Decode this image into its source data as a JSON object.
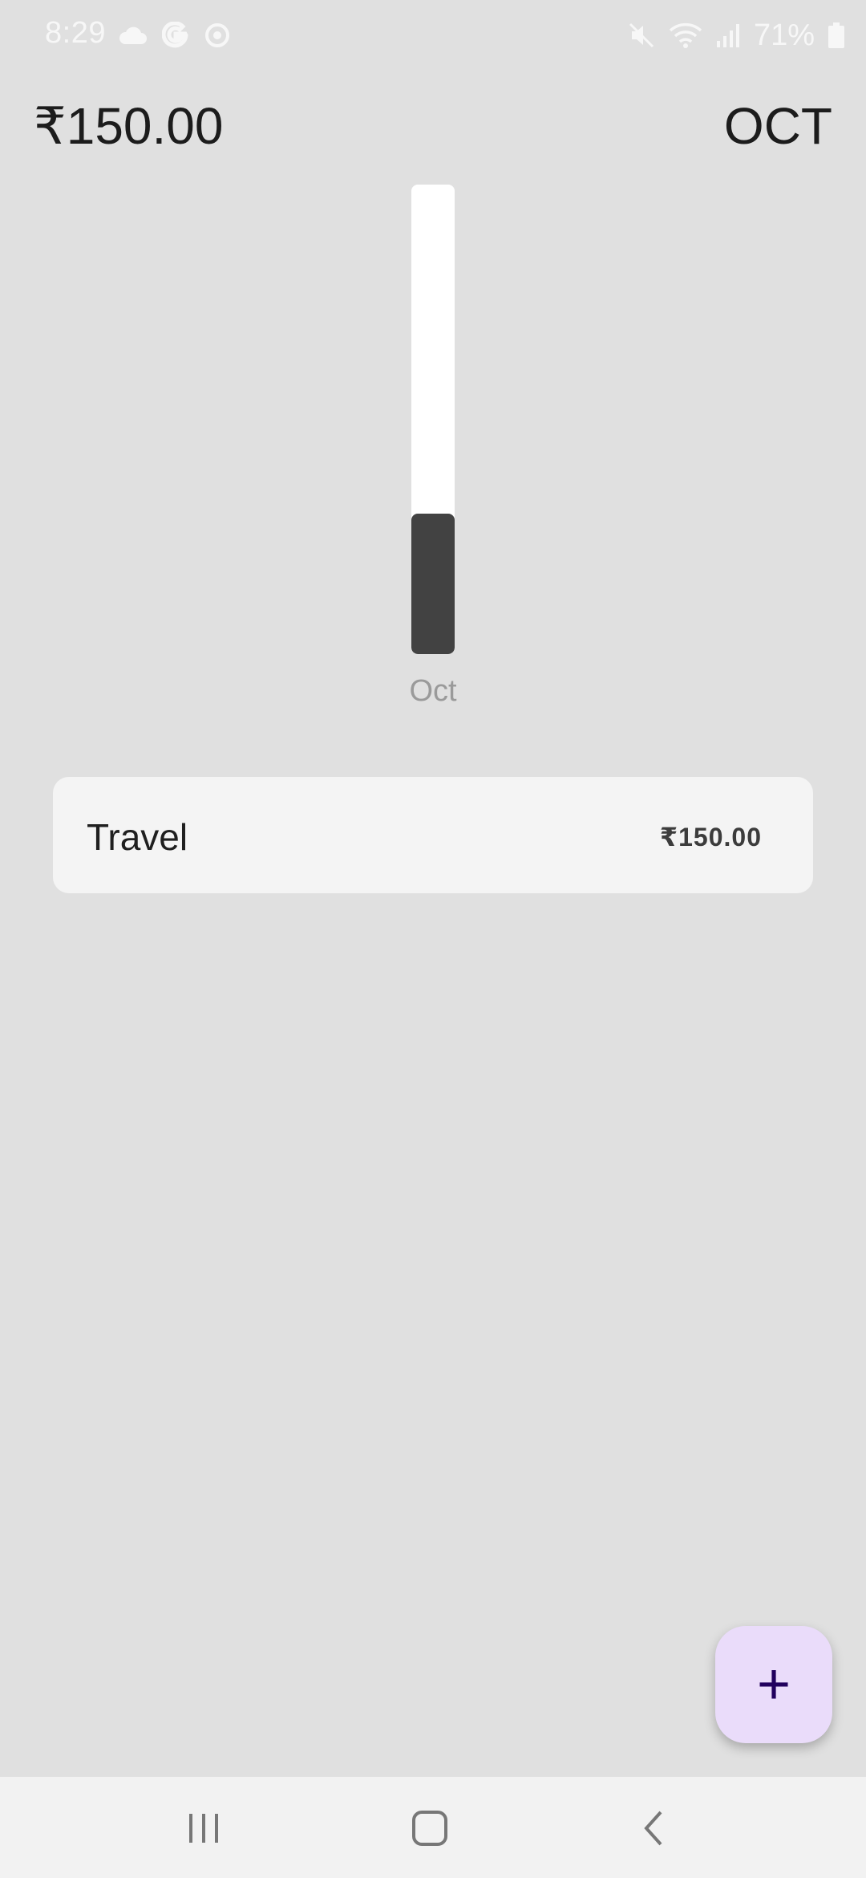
{
  "status_bar": {
    "time": "8:29",
    "battery_percent": "71%",
    "left_icons": [
      "cloud-icon",
      "google-icon",
      "target-icon"
    ],
    "right_icons": [
      "mute-icon",
      "wifi-icon",
      "signal-icon",
      "battery-icon"
    ]
  },
  "header": {
    "total": "₹150.00",
    "month": "OCT"
  },
  "chart_data": {
    "type": "bar",
    "categories": [
      "Oct"
    ],
    "values": [
      0.3
    ],
    "note": "Bar fill fraction of track"
  },
  "expenses": [
    {
      "category": "Travel",
      "amount": "₹150.00"
    }
  ],
  "fab": {
    "label": "+",
    "icon": "plus-icon"
  },
  "nav": {
    "icons": [
      "recents-icon",
      "home-icon",
      "back-icon"
    ]
  },
  "colors": {
    "background": "#e0e0e0",
    "bar_fill": "#424242",
    "bar_track": "#ffffff",
    "fab_background": "#eadcfa",
    "fab_icon": "#21005d"
  }
}
